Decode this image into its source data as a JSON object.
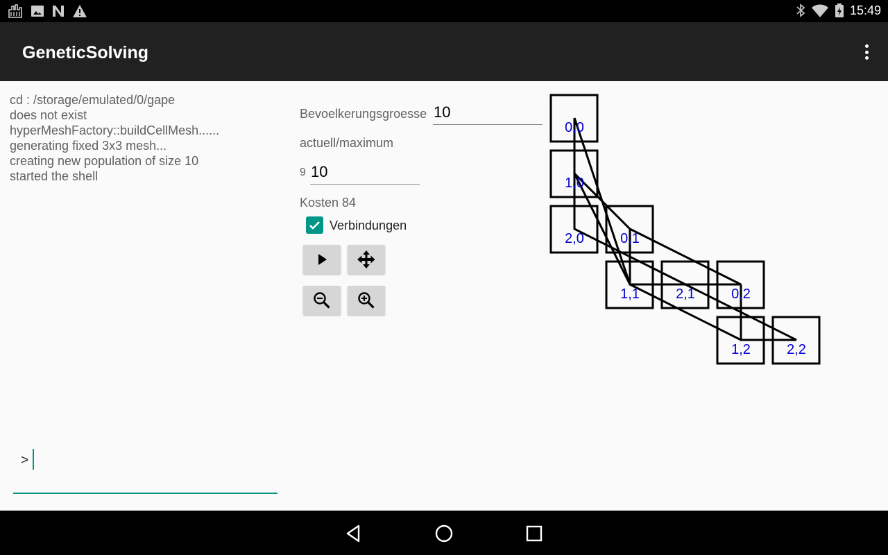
{
  "status_bar": {
    "time": "15:49",
    "left_icons": [
      "city-icon",
      "image-icon",
      "n-logo-icon",
      "warning-icon"
    ],
    "right_icons": [
      "bluetooth-icon",
      "wifi-icon",
      "battery-icon"
    ]
  },
  "app_bar": {
    "title": "GeneticSolving",
    "overflow_icon": "more-vert-icon"
  },
  "log": {
    "lines": [
      "cd : /storage/emulated/0/gape",
      "does not exist",
      "hyperMeshFactory::buildCellMesh......",
      "generating fixed 3x3 mesh...",
      "creating new population of size 10",
      "started the shell"
    ]
  },
  "shell": {
    "prompt": ">",
    "value": ""
  },
  "controls": {
    "population_label": "Bevoelkerungsgroesse",
    "population_value": "10",
    "generation_label": "actuell/maximum",
    "generation_current": "9",
    "generation_max": "10",
    "cost_label": "Kosten",
    "cost_value": "84",
    "connections_label": "Verbindungen",
    "connections_checked": true,
    "buttons": [
      "play-icon",
      "move-icon",
      "zoom-out-icon",
      "zoom-in-icon"
    ]
  },
  "mesh": {
    "cells": [
      "0,0",
      "1,0",
      "2,0",
      "0,1",
      "1,1",
      "2,1",
      "0,2",
      "1,2",
      "2,2"
    ],
    "label_color": "#0000cc",
    "box_color": "#000000"
  },
  "nav_bar": {
    "icons": [
      "back-icon",
      "home-icon",
      "recents-icon"
    ]
  }
}
